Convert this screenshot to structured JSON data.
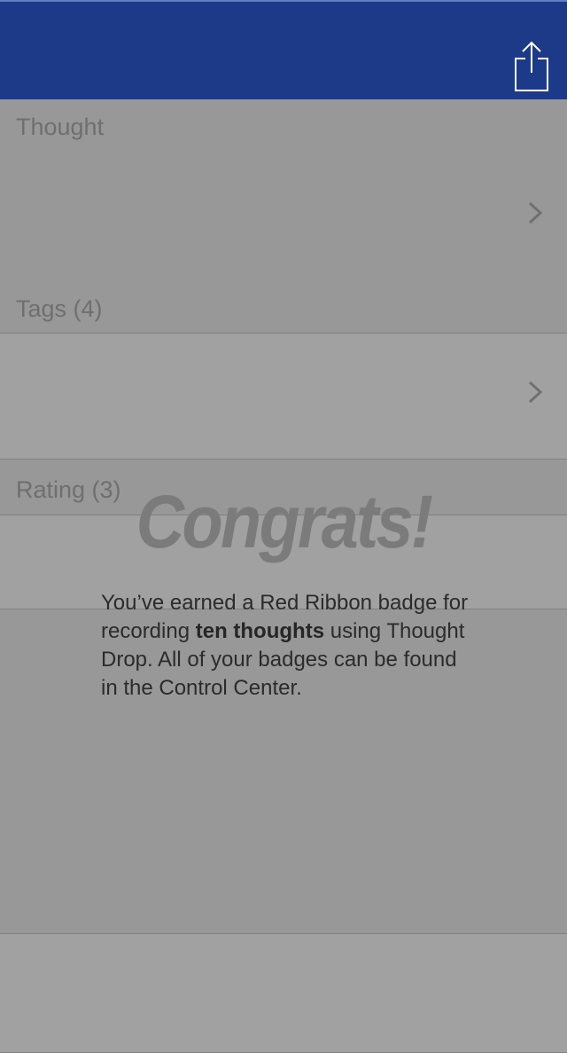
{
  "navbar": {
    "share_icon": "share-icon"
  },
  "thought_section": {
    "label": "Thought",
    "chevron_icon": "chevron-right-icon"
  },
  "tags_section": {
    "label": "Tags (4)",
    "chevron_icon": "chevron-right-icon"
  },
  "rating_section": {
    "label": "Rating (3)"
  },
  "badge_popup": {
    "title": "Congrats!",
    "message_part1": "You’ve earned a Red Ribbon badge for recording ",
    "message_bold": "ten thoughts",
    "message_part2": " using Thought Drop. All of your badges can be found in the Control Center."
  }
}
